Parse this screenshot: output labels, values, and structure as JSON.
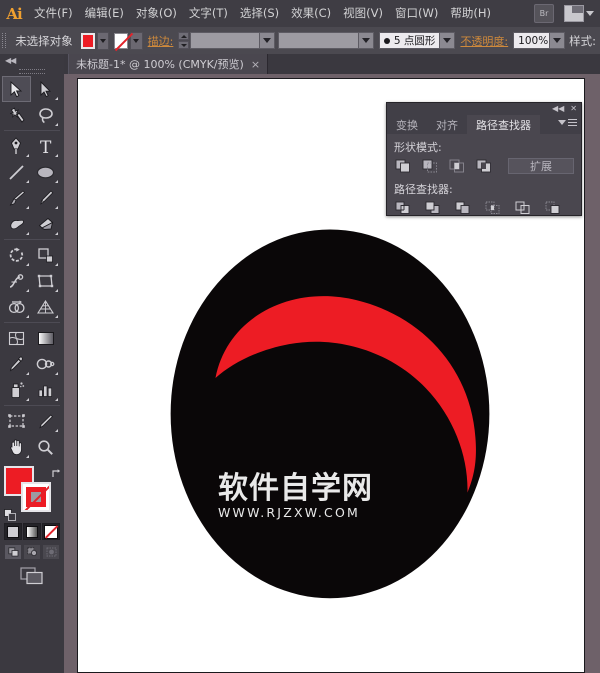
{
  "app": {
    "name": "Adobe Illustrator",
    "logo_text": "Ai"
  },
  "menubar": {
    "items": [
      {
        "label": "文件(F)",
        "name": "menu-file"
      },
      {
        "label": "编辑(E)",
        "name": "menu-edit"
      },
      {
        "label": "对象(O)",
        "name": "menu-object"
      },
      {
        "label": "文字(T)",
        "name": "menu-type"
      },
      {
        "label": "选择(S)",
        "name": "menu-select"
      },
      {
        "label": "效果(C)",
        "name": "menu-effect"
      },
      {
        "label": "视图(V)",
        "name": "menu-view"
      },
      {
        "label": "窗口(W)",
        "name": "menu-window"
      },
      {
        "label": "帮助(H)",
        "name": "menu-help"
      }
    ],
    "bridge_label": "Br",
    "workspace_label": ""
  },
  "controlbar": {
    "selection_status": "未选择对象",
    "fill_color": "#ed1c24",
    "stroke_color": "none",
    "stroke_label": "描边:",
    "stroke_weight": "",
    "stroke_profile": "",
    "brush_definition": "5 点圆形",
    "opacity_label": "不透明度:",
    "opacity_value": "100%",
    "style_label": "样式:"
  },
  "document_tab": {
    "title": "未标题-1* @ 100% (CMYK/预览)",
    "close_glyph": "×"
  },
  "toolbar": {
    "tools": [
      {
        "name": "selection-tool",
        "label": "选择工具",
        "selected": true
      },
      {
        "name": "direct-selection-tool",
        "label": "直接选择工具",
        "selected": false
      },
      {
        "name": "magic-wand-tool",
        "label": "魔棒工具",
        "selected": false
      },
      {
        "name": "lasso-tool",
        "label": "套索工具",
        "selected": false
      },
      {
        "name": "pen-tool",
        "label": "钢笔工具",
        "selected": false
      },
      {
        "name": "type-tool",
        "label": "文字工具",
        "selected": false
      },
      {
        "name": "line-segment-tool",
        "label": "直线段工具",
        "selected": false
      },
      {
        "name": "ellipse-tool",
        "label": "椭圆工具",
        "selected": false
      },
      {
        "name": "paintbrush-tool",
        "label": "画笔工具",
        "selected": false
      },
      {
        "name": "pencil-tool",
        "label": "铅笔工具",
        "selected": false
      },
      {
        "name": "blob-brush-tool",
        "label": "斑点画笔工具",
        "selected": false
      },
      {
        "name": "eraser-tool",
        "label": "橡皮擦工具",
        "selected": false
      },
      {
        "name": "rotate-tool",
        "label": "旋转工具",
        "selected": false
      },
      {
        "name": "scale-tool",
        "label": "比例缩放工具",
        "selected": false
      },
      {
        "name": "width-tool",
        "label": "宽度工具",
        "selected": false
      },
      {
        "name": "free-transform-tool",
        "label": "自由变换工具",
        "selected": false
      },
      {
        "name": "shape-builder-tool",
        "label": "形状生成器工具",
        "selected": false
      },
      {
        "name": "perspective-grid-tool",
        "label": "透视网格工具",
        "selected": false
      },
      {
        "name": "mesh-tool",
        "label": "网格工具",
        "selected": false
      },
      {
        "name": "gradient-tool",
        "label": "渐变工具",
        "selected": false
      },
      {
        "name": "eyedropper-tool",
        "label": "吸管工具",
        "selected": false
      },
      {
        "name": "blend-tool",
        "label": "混合工具",
        "selected": false
      },
      {
        "name": "symbol-sprayer-tool",
        "label": "符号喷枪工具",
        "selected": false
      },
      {
        "name": "column-graph-tool",
        "label": "柱形图工具",
        "selected": false
      },
      {
        "name": "artboard-tool",
        "label": "画板工具",
        "selected": false
      },
      {
        "name": "slice-tool",
        "label": "切片工具",
        "selected": false
      },
      {
        "name": "hand-tool",
        "label": "抓手工具",
        "selected": false
      },
      {
        "name": "zoom-tool",
        "label": "缩放工具",
        "selected": false
      }
    ],
    "fill_stroke": {
      "fill_color": "#ed1c24",
      "stroke_color": "#ed1c24",
      "stroke_is_none": true
    },
    "color_modes": [
      "color-mode",
      "gradient-mode",
      "none-mode"
    ],
    "draw_modes": [
      "draw-normal",
      "draw-behind",
      "draw-inside"
    ],
    "screen_mode": "screen-mode"
  },
  "panel": {
    "tabs": [
      {
        "label": "变换",
        "name": "tab-transform",
        "active": false
      },
      {
        "label": "对齐",
        "name": "tab-align",
        "active": false
      },
      {
        "label": "路径查找器",
        "name": "tab-pathfinder",
        "active": true
      }
    ],
    "shape_modes_label": "形状模式:",
    "shape_modes": [
      {
        "name": "unite-button",
        "label": "联集"
      },
      {
        "name": "minus-front-button",
        "label": "减去顶层"
      },
      {
        "name": "intersect-button",
        "label": "交集"
      },
      {
        "name": "exclude-button",
        "label": "差集"
      }
    ],
    "expand_label": "扩展",
    "pathfinders_label": "路径查找器:",
    "pathfinders": [
      {
        "name": "divide-button",
        "label": "分割"
      },
      {
        "name": "trim-button",
        "label": "修边"
      },
      {
        "name": "merge-button",
        "label": "合并"
      },
      {
        "name": "crop-button",
        "label": "裁剪"
      },
      {
        "name": "outline-button",
        "label": "轮廓"
      },
      {
        "name": "minus-back-button",
        "label": "减去后方对象"
      }
    ],
    "collapse_glyph": "◀◀",
    "close_glyph": "✕"
  },
  "artwork": {
    "ellipse_color": "#0a0708",
    "crescent_color": "#ed1c24",
    "background": "#ffffff",
    "watermark_cn": "软件自学网",
    "watermark_url": "WWW.RJZXW.COM"
  },
  "colors": {
    "chrome_bg": "#3b3940",
    "menubar_bg": "#3f3d44",
    "controlbar_bg": "#4b4950",
    "canvas_bg": "#6e6169",
    "accent_orange": "#cf8a3c",
    "accent_red": "#ed1c24"
  }
}
